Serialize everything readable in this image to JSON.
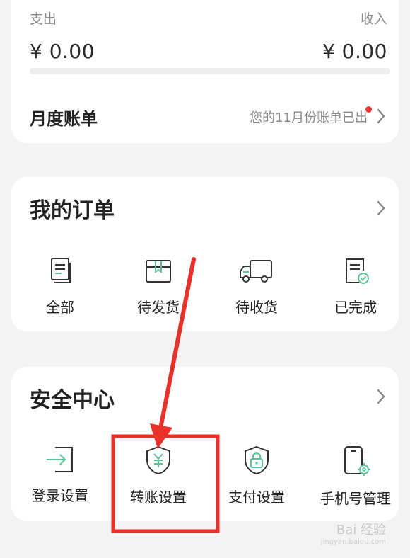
{
  "summary": {
    "expense_label": "支出",
    "expense_amount": "¥ 0.00",
    "income_label": "收入",
    "income_amount": "¥ 0.00",
    "monthly_bill_title": "月度账单",
    "monthly_bill_notice": "您的11月份账单已出"
  },
  "orders": {
    "title": "我的订单",
    "items": [
      {
        "label": "全部",
        "icon": "document-copy-icon"
      },
      {
        "label": "待发货",
        "icon": "package-box-icon"
      },
      {
        "label": "待收货",
        "icon": "delivery-truck-icon"
      },
      {
        "label": "已完成",
        "icon": "completed-document-icon"
      }
    ]
  },
  "security": {
    "title": "安全中心",
    "items": [
      {
        "label": "登录设置",
        "icon": "login-arrow-icon"
      },
      {
        "label": "转账设置",
        "icon": "yuan-shield-icon"
      },
      {
        "label": "支付设置",
        "icon": "lock-shield-icon"
      },
      {
        "label": "手机号管理",
        "icon": "phone-gear-icon"
      }
    ]
  },
  "watermark": {
    "text": "Bai 经验",
    "sub": "jingyan.baidu.com"
  },
  "colors": {
    "accent_green": "#5cc49a",
    "annotation_red": "#e8312a",
    "notification_dot": "#e53935",
    "background": "#f3f3f3"
  }
}
